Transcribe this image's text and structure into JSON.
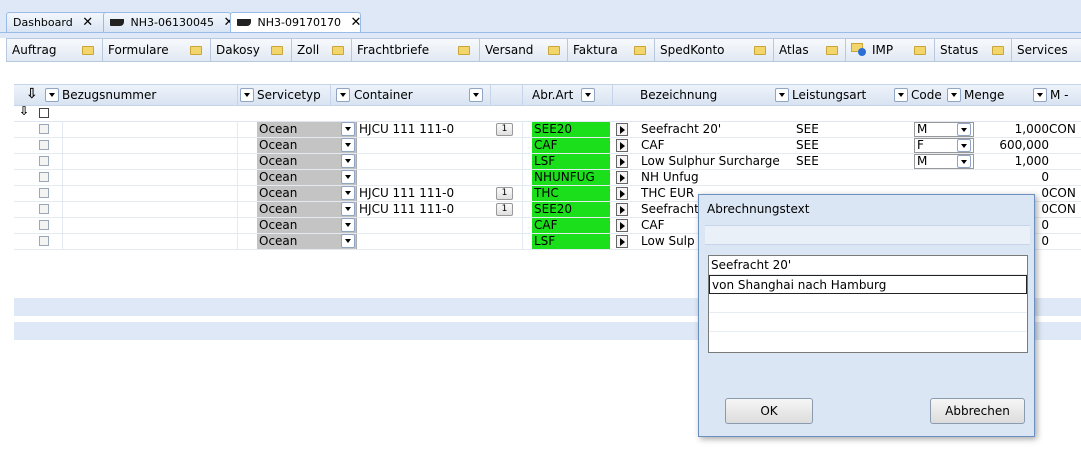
{
  "tabs": [
    {
      "label": "Dashboard",
      "active": false,
      "ship": false
    },
    {
      "label": "NH3-06130045",
      "active": false,
      "ship": true
    },
    {
      "label": "NH3-09170170",
      "active": true,
      "ship": true
    }
  ],
  "close_glyph": "✕",
  "menu": [
    {
      "label": "Auftrag"
    },
    {
      "label": "Formulare"
    },
    {
      "label": "Dakosy"
    },
    {
      "label": "Zoll"
    },
    {
      "label": "Frachtbriefe"
    },
    {
      "label": "Versand"
    },
    {
      "label": "Faktura"
    },
    {
      "label": "SpedKonto"
    },
    {
      "label": "Atlas"
    },
    {
      "label": "IMP"
    },
    {
      "label": "Status"
    },
    {
      "label": "Services"
    }
  ],
  "grid": {
    "headers": {
      "bezugsnummer": "Bezugsnummer",
      "servicetyp": "Servicetyp",
      "container": "Container",
      "abr_art": "Abr.Art",
      "bezeichnung": "Bezeichnung",
      "leistungsart": "Leistungsart",
      "code": "Code",
      "menge": "Menge",
      "m": "M -"
    },
    "rows": [
      {
        "servicetyp": "Ocean",
        "container": "HJCU 111 111-0",
        "num": "1",
        "abr_art": "SEE20",
        "bezeichnung": "Seefracht 20'",
        "leistungsart": "SEE",
        "code": "M",
        "menge": "1,000",
        "m": "CON"
      },
      {
        "servicetyp": "Ocean",
        "container": "",
        "num": "",
        "abr_art": "CAF",
        "bezeichnung": "CAF",
        "leistungsart": "SEE",
        "code": "F",
        "menge": "600,000",
        "m": ""
      },
      {
        "servicetyp": "Ocean",
        "container": "",
        "num": "",
        "abr_art": "LSF",
        "bezeichnung": "Low Sulphur Surcharge",
        "leistungsart": "SEE",
        "code": "M",
        "menge": "1,000",
        "m": ""
      },
      {
        "servicetyp": "Ocean",
        "container": "",
        "num": "",
        "abr_art": "NHUNFUG",
        "bezeichnung": "NH Unfug",
        "leistungsart": "",
        "code": "",
        "menge": "0",
        "m": ""
      },
      {
        "servicetyp": "Ocean",
        "container": "HJCU 111 111-0",
        "num": "1",
        "abr_art": "THC",
        "bezeichnung": "THC EUR",
        "leistungsart": "",
        "code": "",
        "menge": "0",
        "m": "CON"
      },
      {
        "servicetyp": "Ocean",
        "container": "HJCU 111 111-0",
        "num": "1",
        "abr_art": "SEE20",
        "bezeichnung": "Seefracht",
        "leistungsart": "",
        "code": "",
        "menge": "0",
        "m": "CON"
      },
      {
        "servicetyp": "Ocean",
        "container": "",
        "num": "",
        "abr_art": "CAF",
        "bezeichnung": "CAF",
        "leistungsart": "",
        "code": "",
        "menge": "0",
        "m": ""
      },
      {
        "servicetyp": "Ocean",
        "container": "",
        "num": "",
        "abr_art": "LSF",
        "bezeichnung": "Low Sulp",
        "leistungsart": "",
        "code": "",
        "menge": "0",
        "m": ""
      }
    ]
  },
  "dialog": {
    "title": "Abrechnungstext",
    "lines": [
      "Seefracht 20'",
      "von Shanghai nach Hamburg"
    ],
    "ok_label": "OK",
    "cancel_label": "Abbrechen"
  },
  "colors": {
    "abr_art_highlight": "#1bdf1b",
    "servicetyp_bg": "#c4c4c4",
    "header_bg": "#dfe8f6"
  }
}
